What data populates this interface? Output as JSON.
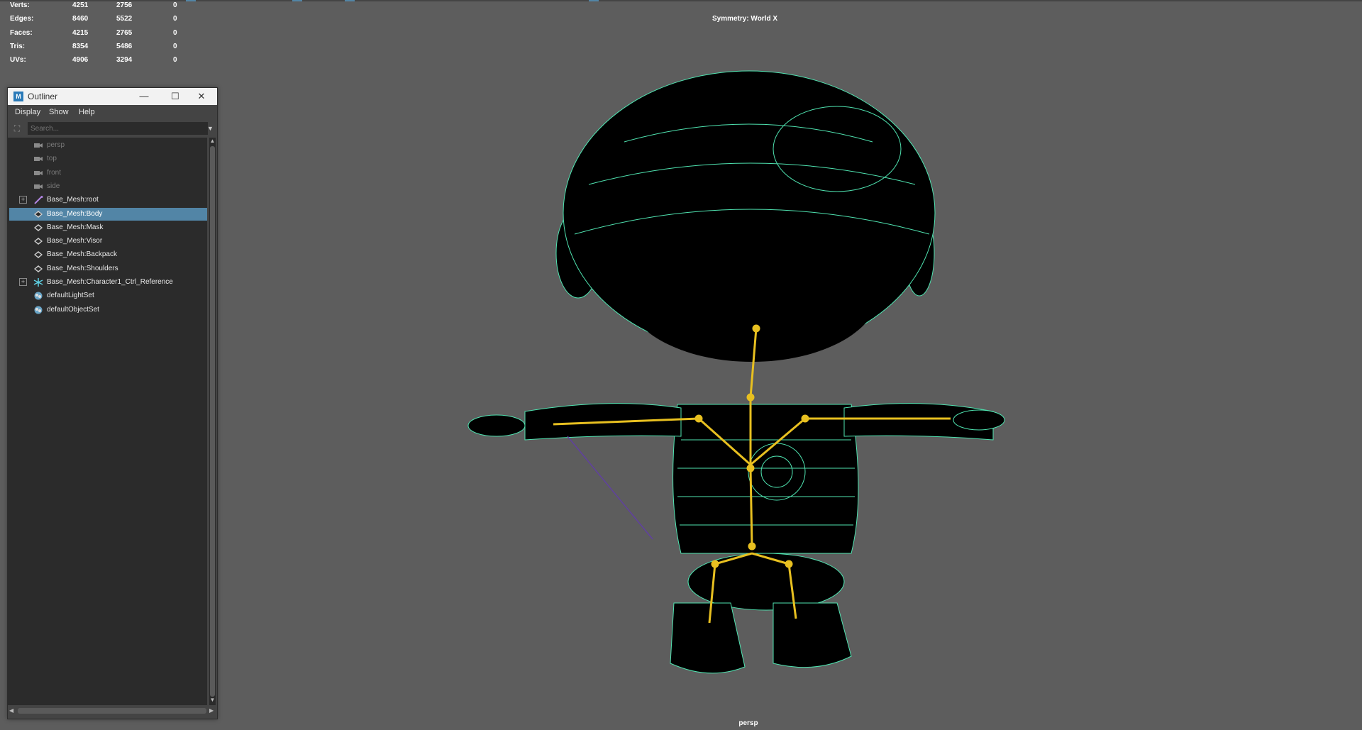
{
  "hud": {
    "rows": [
      {
        "label": "Verts:",
        "c1": "4251",
        "c2": "2756",
        "c3": "0"
      },
      {
        "label": "Edges:",
        "c1": "8460",
        "c2": "5522",
        "c3": "0"
      },
      {
        "label": "Faces:",
        "c1": "4215",
        "c2": "2765",
        "c3": "0"
      },
      {
        "label": "Tris:",
        "c1": "8354",
        "c2": "5486",
        "c3": "0"
      },
      {
        "label": "UVs:",
        "c1": "4906",
        "c2": "3294",
        "c3": "0"
      }
    ]
  },
  "viewport": {
    "symmetry": "Symmetry: World X",
    "camera": "persp"
  },
  "outliner": {
    "title": "Outliner",
    "window_buttons": {
      "minimize": "—",
      "maximize": "☐",
      "close": "✕"
    },
    "menu": [
      "Display",
      "Show",
      "Help"
    ],
    "search_placeholder": "Search...",
    "items": [
      {
        "label": "persp",
        "icon": "camera-icon",
        "state": "dim"
      },
      {
        "label": "top",
        "icon": "camera-icon",
        "state": "dim"
      },
      {
        "label": "front",
        "icon": "camera-icon",
        "state": "dim"
      },
      {
        "label": "side",
        "icon": "camera-icon",
        "state": "dim"
      },
      {
        "label": "Base_Mesh:root",
        "icon": "joint-icon",
        "state": "normal",
        "expandable": true
      },
      {
        "label": "Base_Mesh:Body",
        "icon": "mesh-icon",
        "state": "selected"
      },
      {
        "label": "Base_Mesh:Mask",
        "icon": "mesh-icon",
        "state": "normal"
      },
      {
        "label": "Base_Mesh:Visor",
        "icon": "mesh-icon",
        "state": "normal"
      },
      {
        "label": "Base_Mesh:Backpack",
        "icon": "mesh-icon",
        "state": "normal"
      },
      {
        "label": "Base_Mesh:Shoulders",
        "icon": "mesh-icon",
        "state": "normal"
      },
      {
        "label": "Base_Mesh:Character1_Ctrl_Reference",
        "icon": "hik-reference-icon",
        "state": "normal",
        "expandable": true
      },
      {
        "label": "defaultLightSet",
        "icon": "set-icon",
        "state": "normal"
      },
      {
        "label": "defaultObjectSet",
        "icon": "set-icon",
        "state": "normal"
      }
    ]
  },
  "colors": {
    "viewport_bg": "#5d5d5d",
    "wireframe": "#4fe3b0",
    "joints": "#e8c020",
    "selection": "#5285a6"
  }
}
